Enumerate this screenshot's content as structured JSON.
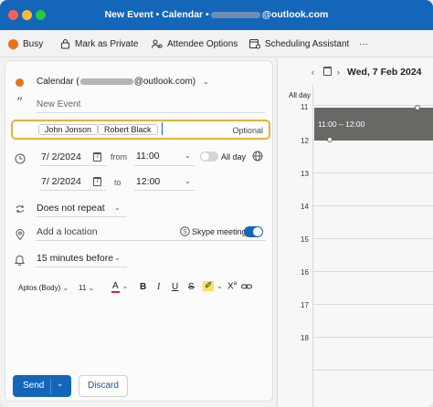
{
  "window": {
    "title_prefix": "New Event • Calendar •",
    "title_suffix": "@outlook.com"
  },
  "toolbar": {
    "busy": "Busy",
    "mark_private": "Mark as Private",
    "attendee_options": "Attendee Options",
    "scheduling_assistant": "Scheduling Assistant",
    "more": "···"
  },
  "form": {
    "calendar_label": "Calendar (",
    "calendar_suffix": "@outlook.com)",
    "title_placeholder": "New Event",
    "attendees": [
      "John Jonson",
      "Robert Black"
    ],
    "optional": "Optional",
    "start_date": "7/ 2/2024",
    "from_label": "from",
    "start_time": "11:00",
    "all_day": "All day",
    "end_date": "7/ 2/2024",
    "to_label": "to",
    "end_time": "12:00",
    "repeat": "Does not repeat",
    "location_placeholder": "Add a location",
    "skype": "Skype meeting",
    "skype_enabled": true,
    "reminder": "15 minutes before",
    "font": "Aptos (Body)",
    "font_size": "11",
    "send": "Send",
    "discard": "Discard"
  },
  "calendar": {
    "date_title": "Wed, 7 Feb 2024",
    "all_day_label": "All day",
    "hours": [
      "11",
      "12",
      "13",
      "14",
      "15",
      "16",
      "17",
      "18"
    ],
    "event_time": "11:00 – 12:00"
  },
  "colors": {
    "accent": "#1466b8",
    "busy": "#e9711c",
    "focus": "#e8b23a",
    "event": "#6a6865"
  }
}
